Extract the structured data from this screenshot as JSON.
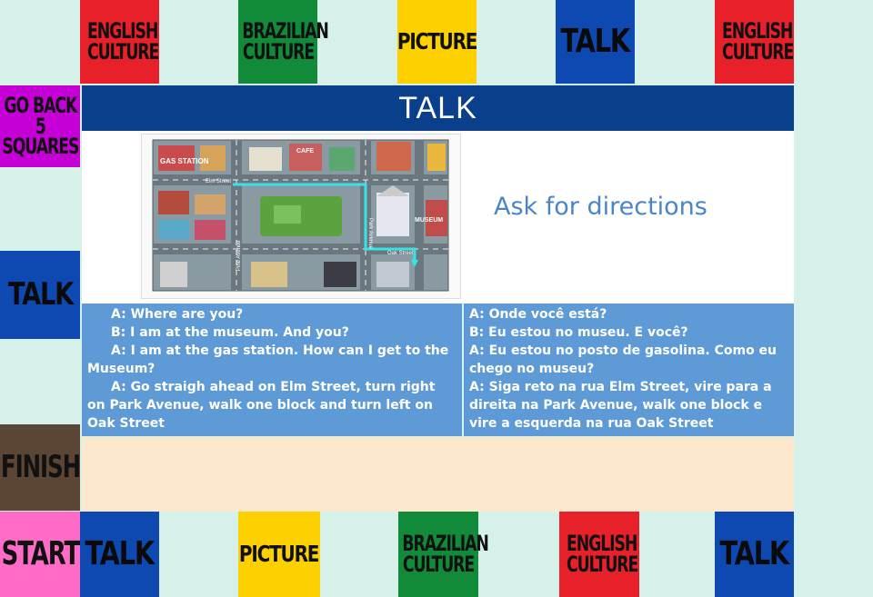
{
  "top_row": [
    {
      "label": "ENGLISH CULTURE",
      "color": "#e8202a"
    },
    {
      "label": "BRAZILIAN CULTURE",
      "color": "#118a3a"
    },
    {
      "label": "PICTURE",
      "color": "#fdd100"
    },
    {
      "label": "TALK",
      "color": "#0d49b0"
    },
    {
      "label": "ENGLISH CULTURE",
      "color": "#e8202a"
    }
  ],
  "left_column": [
    {
      "label": "GO BACK 5 SQUARES",
      "color": "#c400d6"
    },
    {
      "label": "TALK",
      "color": "#0d49b0"
    },
    {
      "label": "FINISH",
      "color": "#5b4636"
    }
  ],
  "bottom_row": [
    {
      "label": "START",
      "color": "#ff6bc7"
    },
    {
      "label": "TALK",
      "color": "#0d49b0"
    },
    {
      "label": "PICTURE",
      "color": "#fdd100"
    },
    {
      "label": "BRAZILIAN CULTURE",
      "color": "#118a3a"
    },
    {
      "label": "ENGLISH CULTURE",
      "color": "#e8202a"
    },
    {
      "label": "TALK",
      "color": "#0d49b0"
    }
  ],
  "card": {
    "title": "TALK",
    "prompt": "Ask for directions",
    "map_labels": {
      "gas_station": "GAS STATION",
      "cafe": "CAFE",
      "museum": "MUSEUM",
      "elm": "Elm Street",
      "park": "Park Avenue",
      "pine": "Pine Avenue",
      "oak": "Oak Street"
    },
    "dialogue_en": [
      "A: Where are you?",
      "B: I am at the museum. And you?",
      "A:  I am at the gas station. How can I get to the Museum?",
      "A: Go straigh ahead on Elm Street, turn right on Park Avenue, walk one block and turn left on Oak Street"
    ],
    "dialogue_pt": [
      "A: Onde você está?",
      "B: Eu estou no museu. E você?",
      "A: Eu estou no posto de gasolina. Como eu chego no museu?",
      "A: Siga reto na rua Elm Street, vire para a direita na Park Avenue, walk one block e vire a esquerda na rua Oak Street"
    ]
  }
}
